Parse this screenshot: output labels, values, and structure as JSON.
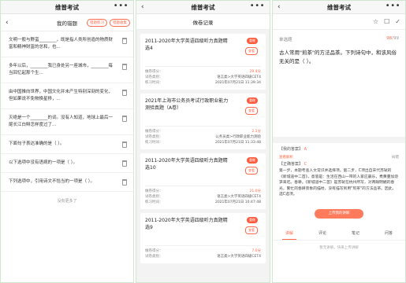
{
  "wechat_title": "维普考试",
  "menu_dots": "•••",
  "back_glyph": "‹",
  "panel1": {
    "page_title": "我的错题",
    "buttons": [
      "错题练习",
      "错题收集"
    ],
    "items": [
      "文明一般与野蛮________，既是指人类所创造的物质财富和精神财富的总和，也...",
      "多年以后，________我已身处另一座城市，________每当回忆起那个生...",
      "由中国推向世界，中国文化并未产生特别深刻的变化，但如果说不免物换星移，...",
      "灭绝是一个________的词。没有人知道，地球上最后一尾长江白鲟怎样度过了...",
      "下面句子表达准确的是（    ）。",
      "以下选项中没有语病的一项是（    ）。",
      "下列选项中，引用诗文不恰当的一项是（    ）。"
    ],
    "no_more": "没有更多了"
  },
  "panel2": {
    "page_title": "做卷记录",
    "badge_retry": "重做",
    "badge_view": "查看",
    "labels": {
      "score": "做卷得分：",
      "category": "试卷类别：",
      "time": "练习时间："
    },
    "records": [
      {
        "title": "2011-2020年大学英语四级听力真题精选4",
        "score": "29.4分",
        "category": "语言类>大学英语四级CET4",
        "time": "2021年07月21日 11:39:34"
      },
      {
        "title": "2021年上海市公务员考试行政职业能力测验真题（A卷）",
        "score": "2.1分",
        "category": "公务员类>行政职业能力测验",
        "time": "2021年07月21日 11:33:48"
      },
      {
        "title": "2011-2020年大学英语四级听力真题精选10",
        "score": "21.0分",
        "category": "语言类>大学英语四级CET4",
        "time": "2021年07月21日 10:47:48"
      },
      {
        "title": "2011-2020年大学英语四级听力真题精选9",
        "score": "7.0分",
        "category": "语言类>大学英语四级CET4",
        "time": ""
      }
    ]
  },
  "panel3": {
    "icons": [
      "☆",
      "☐",
      "✓"
    ],
    "question_type": "单选题",
    "progress_current": "98",
    "progress_total": "/99",
    "question": "古人常用\"煎茶\"的方法品茶。下列诗句中，和该风俗无关的是（    ）。",
    "my_answer_label": "【我的答案】",
    "my_answer": "A",
    "view_analysis": "查看解析",
    "correct_answer_label": "【正确答案】",
    "correct_answer": "C",
    "correction": "纠错",
    "explanation": "第一步，本题考查人文常识并选择项。第二步，C项出自宋代苏轼的《新城道中二首》，意思是：生活在西山一带的人家应最乐，煮黄蔓加烧笋来吃。春耕。《新城道中二首》是苏轼在杭州所写，对两眼明媚的春光，繁忙的春耕景象的描绘，没有描写到用\"煎茶\"的方法品茶。因此，选C选项。",
    "upload_button": "上传我的讲解",
    "tabs": [
      "讲解",
      "评论",
      "笔记",
      "问答"
    ],
    "empty_text": "暂无讲解，快来上传讲解"
  },
  "colors": {
    "accent": "#ff6b4a",
    "border": "#cfe6cf"
  }
}
